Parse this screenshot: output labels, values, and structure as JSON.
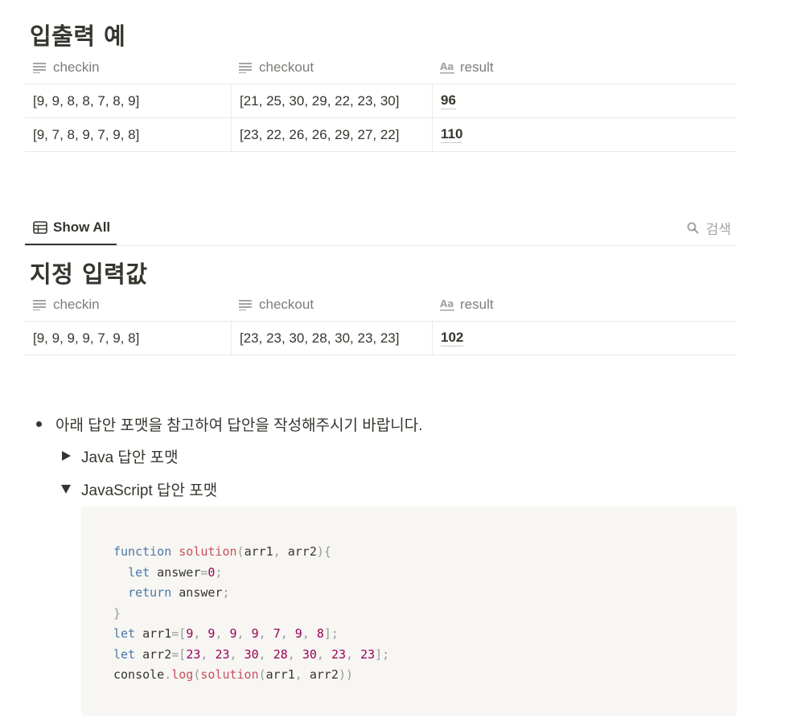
{
  "sections": [
    {
      "title": "입출력 예",
      "columns": [
        "checkin",
        "checkout",
        "result"
      ],
      "rows": [
        {
          "checkin": "[9, 9, 8, 8, 7, 8, 9]",
          "checkout": "[21, 25, 30, 29, 22, 23, 30]",
          "result": "96"
        },
        {
          "checkin": "[9, 7, 8, 9, 7, 9, 8]",
          "checkout": "[23, 22, 26, 26, 29, 27, 22]",
          "result": "110"
        }
      ]
    },
    {
      "title": "지정 입력값",
      "columns": [
        "checkin",
        "checkout",
        "result"
      ],
      "rows": [
        {
          "checkin": "[9, 9, 9, 9, 7, 9, 8]",
          "checkout": "[23, 23, 30, 28, 30, 23, 23]",
          "result": "102"
        }
      ]
    }
  ],
  "view_bar": {
    "tab_label": "Show All",
    "search_label": "검색"
  },
  "instructions": {
    "bullet": "아래 답안 포맷을 참고하여 답안을 작성해주시기 바랍니다.",
    "toggles": [
      {
        "label": "Java 답안 포맷",
        "expanded": false
      },
      {
        "label": "JavaScript 답안 포맷",
        "expanded": true
      }
    ]
  },
  "code": {
    "language": "javascript",
    "lines": [
      [
        {
          "t": "kw",
          "v": "function"
        },
        {
          "t": "plain",
          "v": " "
        },
        {
          "t": "fn",
          "v": "solution"
        },
        {
          "t": "punc",
          "v": "("
        },
        {
          "t": "plain",
          "v": "arr1"
        },
        {
          "t": "punc",
          "v": ","
        },
        {
          "t": "plain",
          "v": " arr2"
        },
        {
          "t": "punc",
          "v": "){"
        }
      ],
      [
        {
          "t": "plain",
          "v": "  "
        },
        {
          "t": "kw",
          "v": "let"
        },
        {
          "t": "plain",
          "v": " answer"
        },
        {
          "t": "punc",
          "v": "="
        },
        {
          "t": "num",
          "v": "0"
        },
        {
          "t": "punc",
          "v": ";"
        }
      ],
      [
        {
          "t": "plain",
          "v": "  "
        },
        {
          "t": "kw",
          "v": "return"
        },
        {
          "t": "plain",
          "v": " answer"
        },
        {
          "t": "punc",
          "v": ";"
        }
      ],
      [
        {
          "t": "punc",
          "v": "}"
        }
      ],
      [
        {
          "t": "kw",
          "v": "let"
        },
        {
          "t": "plain",
          "v": " arr1"
        },
        {
          "t": "punc",
          "v": "=["
        },
        {
          "t": "num",
          "v": "9"
        },
        {
          "t": "punc",
          "v": ","
        },
        {
          "t": "plain",
          "v": " "
        },
        {
          "t": "num",
          "v": "9"
        },
        {
          "t": "punc",
          "v": ","
        },
        {
          "t": "plain",
          "v": " "
        },
        {
          "t": "num",
          "v": "9"
        },
        {
          "t": "punc",
          "v": ","
        },
        {
          "t": "plain",
          "v": " "
        },
        {
          "t": "num",
          "v": "9"
        },
        {
          "t": "punc",
          "v": ","
        },
        {
          "t": "plain",
          "v": " "
        },
        {
          "t": "num",
          "v": "7"
        },
        {
          "t": "punc",
          "v": ","
        },
        {
          "t": "plain",
          "v": " "
        },
        {
          "t": "num",
          "v": "9"
        },
        {
          "t": "punc",
          "v": ","
        },
        {
          "t": "plain",
          "v": " "
        },
        {
          "t": "num",
          "v": "8"
        },
        {
          "t": "punc",
          "v": "];"
        }
      ],
      [
        {
          "t": "kw",
          "v": "let"
        },
        {
          "t": "plain",
          "v": " arr2"
        },
        {
          "t": "punc",
          "v": "=["
        },
        {
          "t": "num",
          "v": "23"
        },
        {
          "t": "punc",
          "v": ","
        },
        {
          "t": "plain",
          "v": " "
        },
        {
          "t": "num",
          "v": "23"
        },
        {
          "t": "punc",
          "v": ","
        },
        {
          "t": "plain",
          "v": " "
        },
        {
          "t": "num",
          "v": "30"
        },
        {
          "t": "punc",
          "v": ","
        },
        {
          "t": "plain",
          "v": " "
        },
        {
          "t": "num",
          "v": "28"
        },
        {
          "t": "punc",
          "v": ","
        },
        {
          "t": "plain",
          "v": " "
        },
        {
          "t": "num",
          "v": "30"
        },
        {
          "t": "punc",
          "v": ","
        },
        {
          "t": "plain",
          "v": " "
        },
        {
          "t": "num",
          "v": "23"
        },
        {
          "t": "punc",
          "v": ","
        },
        {
          "t": "plain",
          "v": " "
        },
        {
          "t": "num",
          "v": "23"
        },
        {
          "t": "punc",
          "v": "];"
        }
      ],
      [
        {
          "t": "plain",
          "v": "console"
        },
        {
          "t": "punc",
          "v": "."
        },
        {
          "t": "fn",
          "v": "log"
        },
        {
          "t": "punc",
          "v": "("
        },
        {
          "t": "fn",
          "v": "solution"
        },
        {
          "t": "punc",
          "v": "("
        },
        {
          "t": "plain",
          "v": "arr1"
        },
        {
          "t": "punc",
          "v": ","
        },
        {
          "t": "plain",
          "v": " arr2"
        },
        {
          "t": "punc",
          "v": "))"
        }
      ]
    ]
  },
  "icons": {
    "text_column": "text-lines-icon",
    "title_column": "aa-title-icon",
    "table_view": "table-icon",
    "search": "search-icon",
    "toggle_collapsed": "triangle-right-icon",
    "toggle_expanded": "triangle-down-icon"
  },
  "colors": {
    "text": "#37352f",
    "border": "#ebeae7",
    "code_bg": "#f7f6f3",
    "code_keyword": "#4a78a6",
    "code_function": "#c94f5f",
    "code_number": "#990055"
  }
}
